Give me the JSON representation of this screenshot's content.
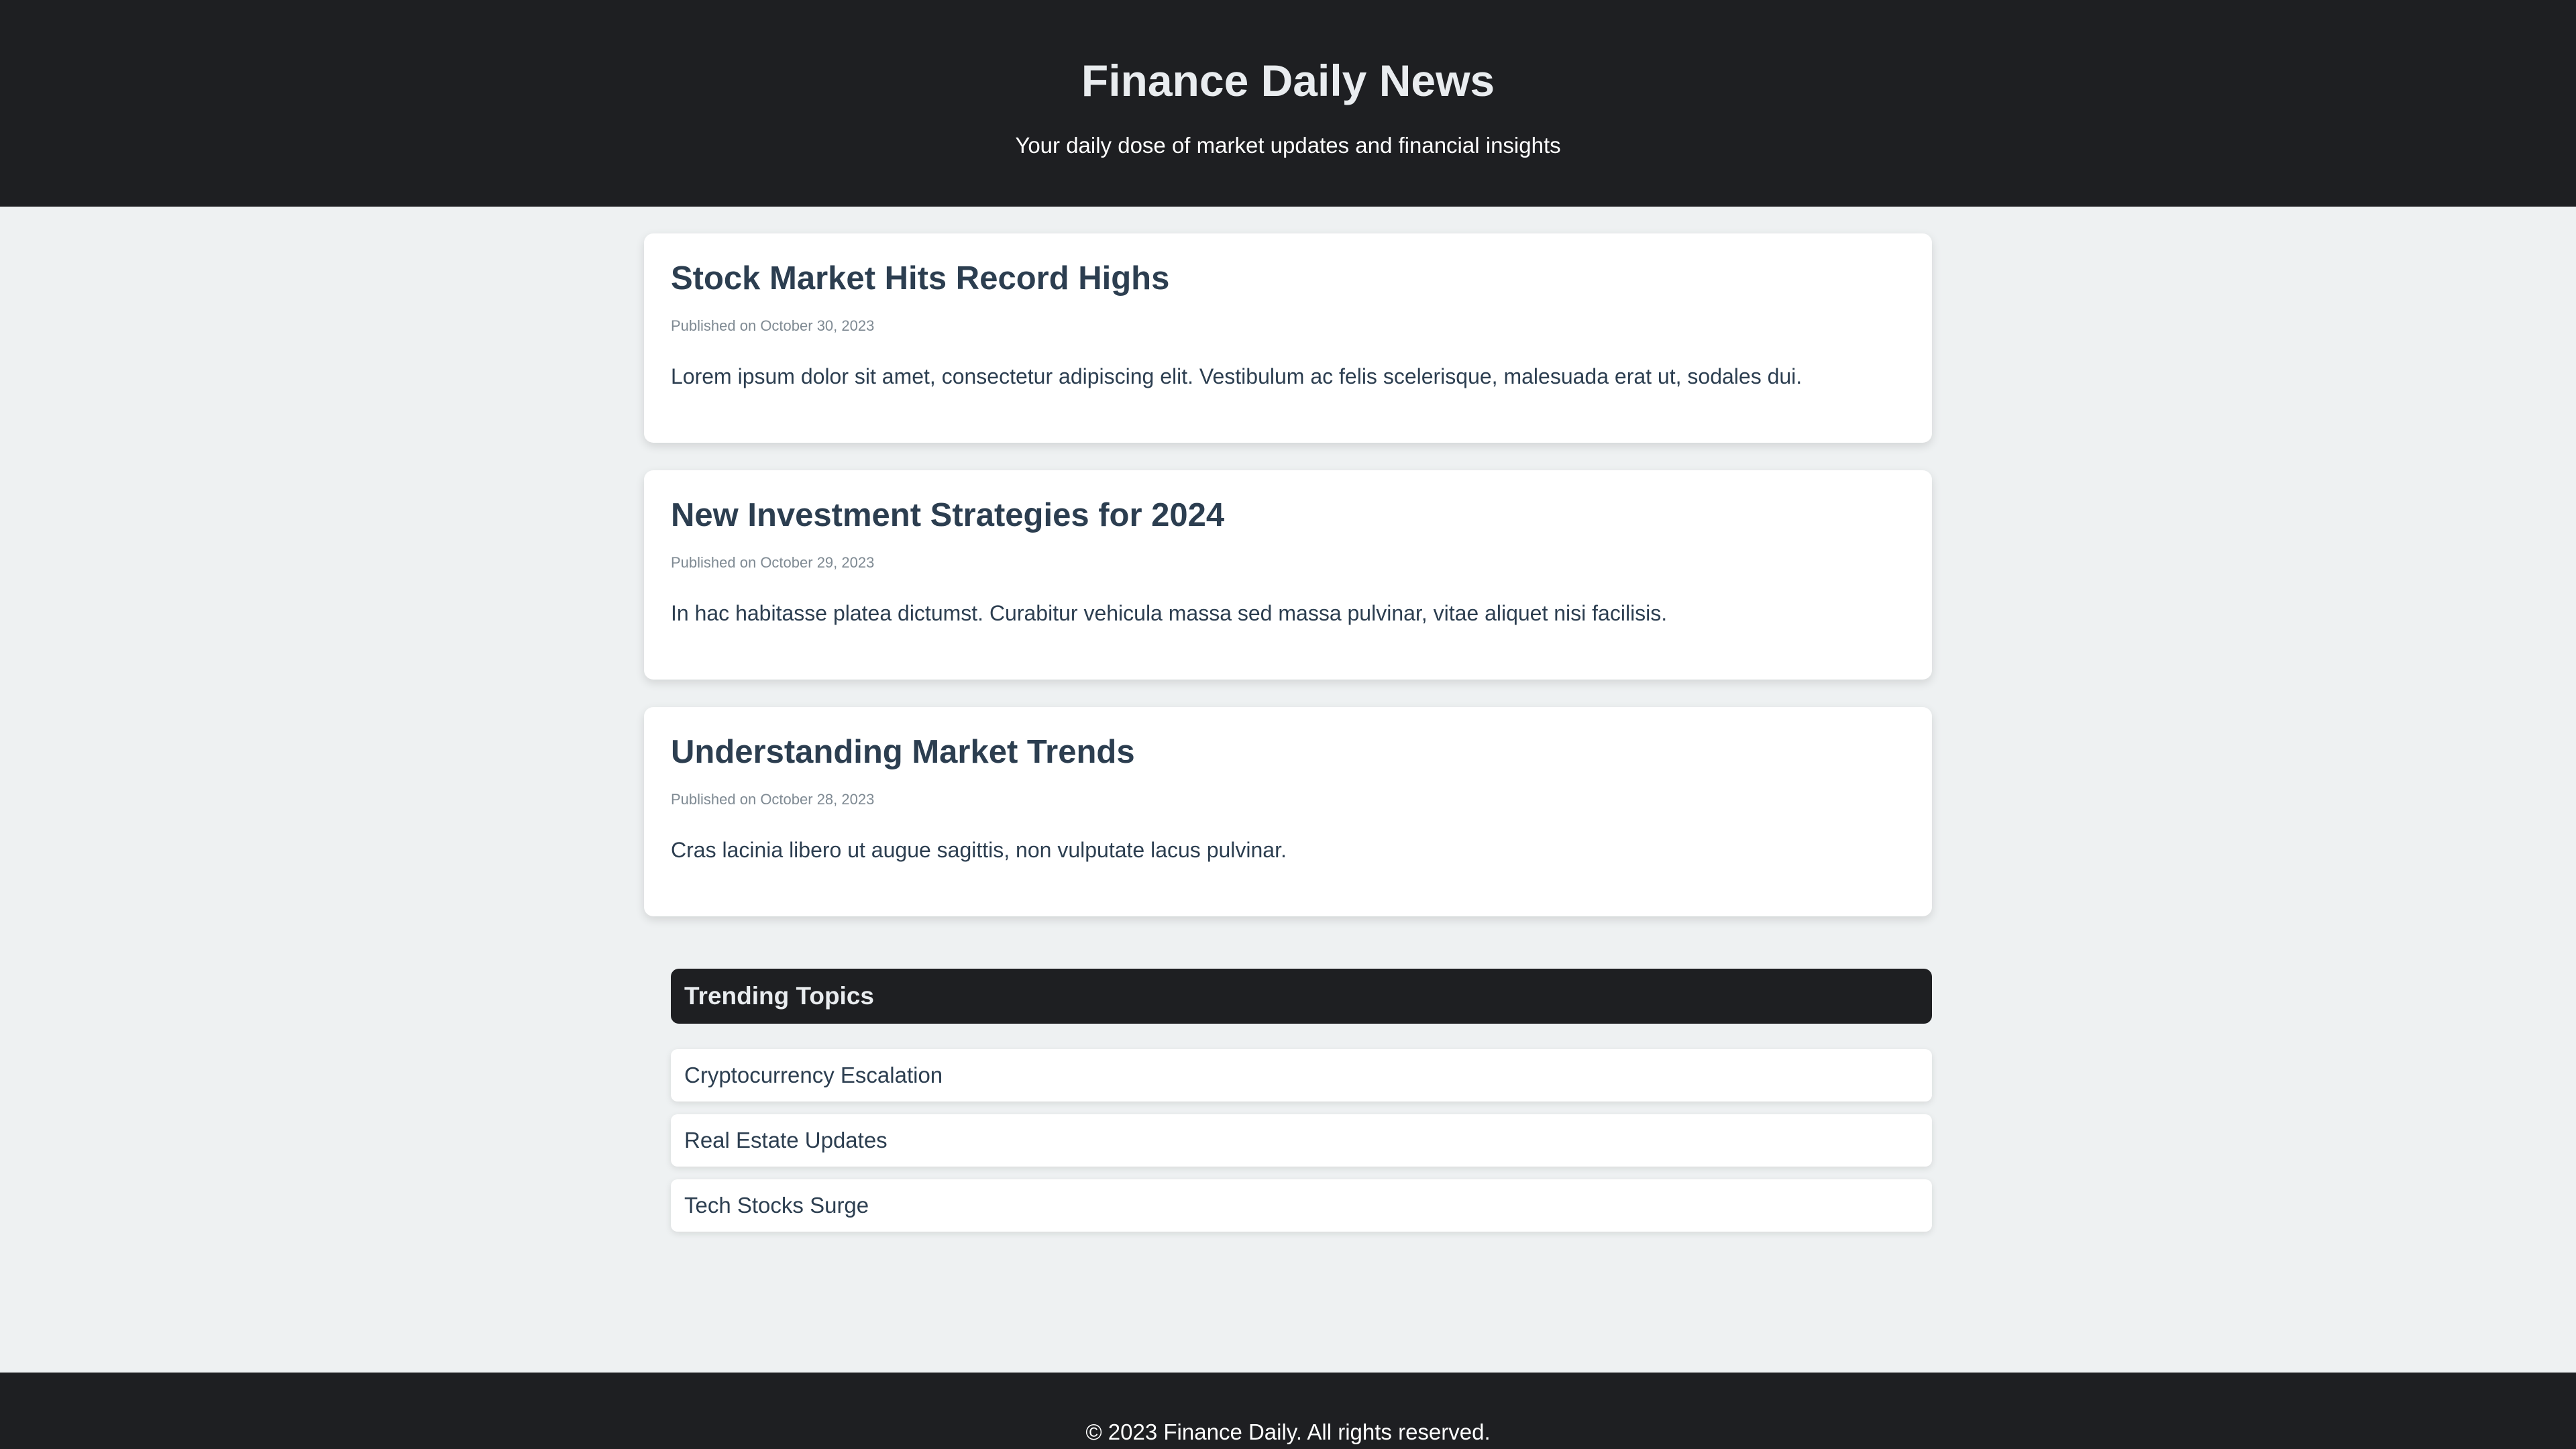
{
  "header": {
    "title": "Finance Daily News",
    "tagline": "Your daily dose of market updates and financial insights"
  },
  "articles": [
    {
      "title": "Stock Market Hits Record Highs",
      "date": "Published on October 30, 2023",
      "body": "Lorem ipsum dolor sit amet, consectetur adipiscing elit. Vestibulum ac felis scelerisque, malesuada erat ut, sodales dui."
    },
    {
      "title": "New Investment Strategies for 2024",
      "date": "Published on October 29, 2023",
      "body": "In hac habitasse platea dictumst. Curabitur vehicula massa sed massa pulvinar, vitae aliquet nisi facilisis."
    },
    {
      "title": "Understanding Market Trends",
      "date": "Published on October 28, 2023",
      "body": "Cras lacinia libero ut augue sagittis, non vulputate lacus pulvinar."
    }
  ],
  "trending": {
    "heading": "Trending Topics",
    "items": [
      "Cryptocurrency Escalation",
      "Real Estate Updates",
      "Tech Stocks Surge"
    ]
  },
  "footer": {
    "text": "© 2023 Finance Daily. All rights reserved."
  },
  "colors": {
    "header_bg": "#1e1f22",
    "page_bg": "#eef1f2",
    "text": "#2c3e50",
    "muted": "#7f8a93"
  }
}
